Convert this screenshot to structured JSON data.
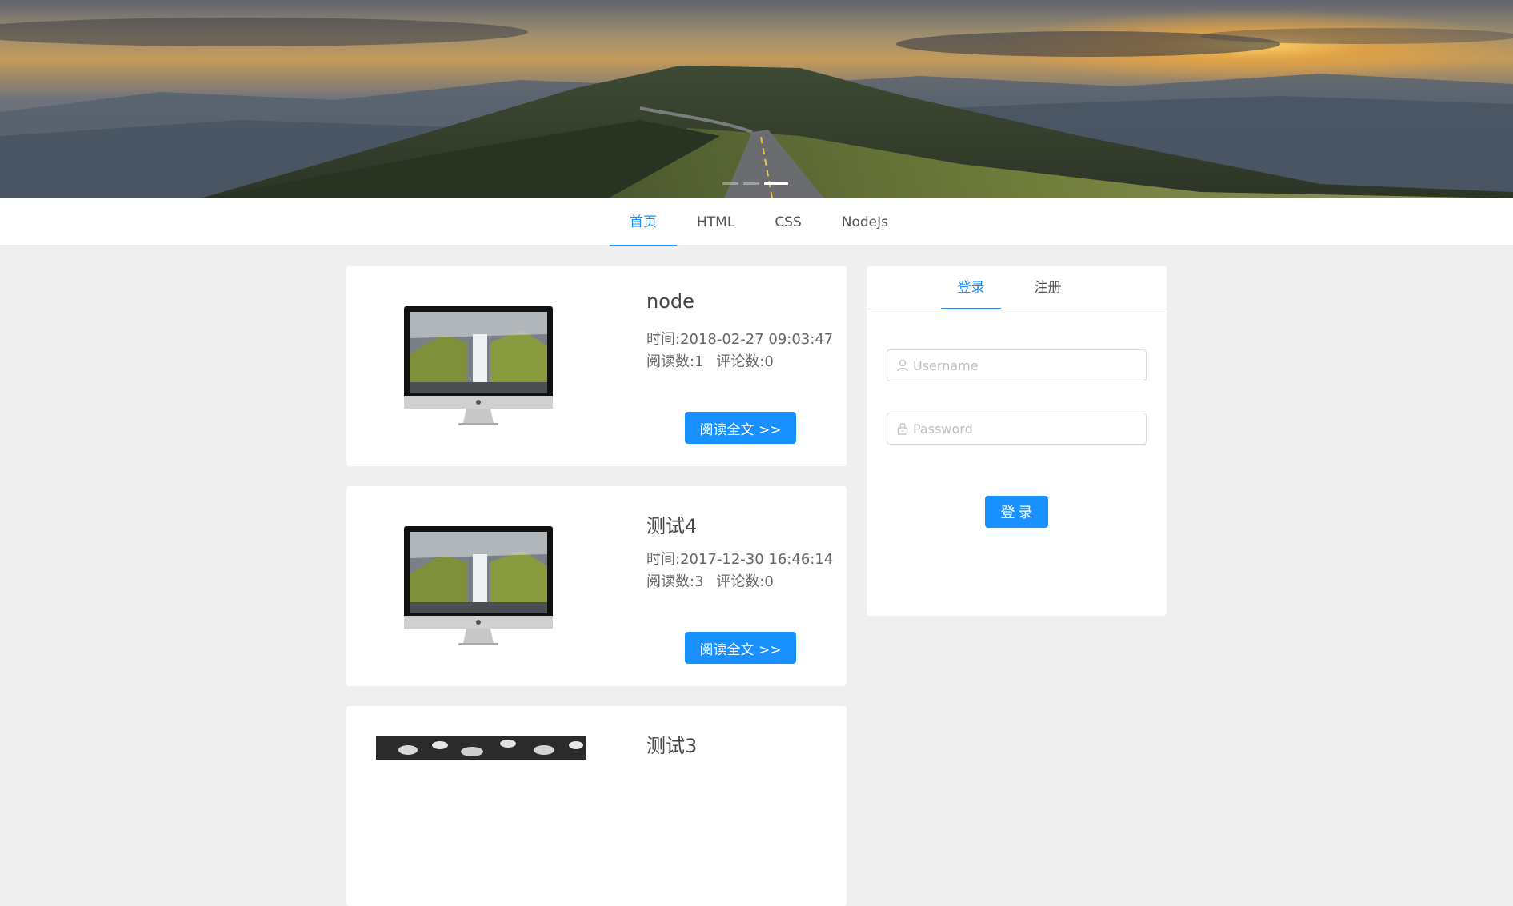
{
  "carousel": {
    "slide_count": 3,
    "active_index": 2
  },
  "nav": {
    "items": [
      {
        "label": "首页",
        "active": true
      },
      {
        "label": "HTML",
        "active": false
      },
      {
        "label": "CSS",
        "active": false
      },
      {
        "label": "NodeJs",
        "active": false
      }
    ]
  },
  "articles": [
    {
      "title": "node",
      "time": "时间:2018-02-27 09:03:47",
      "reads": "阅读数:1",
      "comments": "评论数:0",
      "button": "阅读全文 >>",
      "thumb": "imac-waterfall"
    },
    {
      "title": "测试4",
      "time": "时间:2017-12-30 16:46:14",
      "reads": "阅读数:3",
      "comments": "评论数:0",
      "button": "阅读全文 >>",
      "thumb": "imac-waterfall"
    },
    {
      "title": "测试3",
      "thumb": "leopard-bw"
    }
  ],
  "auth": {
    "tabs": [
      {
        "label": "登录",
        "active": true
      },
      {
        "label": "注册",
        "active": false
      }
    ],
    "username": {
      "placeholder": "Username",
      "value": "",
      "icon": "user-icon"
    },
    "password": {
      "placeholder": "Password",
      "value": "",
      "icon": "lock-icon"
    },
    "submit_label": "登录"
  },
  "colors": {
    "primary": "#1890ff",
    "page_bg": "#efefef",
    "card_bg": "#ffffff"
  }
}
